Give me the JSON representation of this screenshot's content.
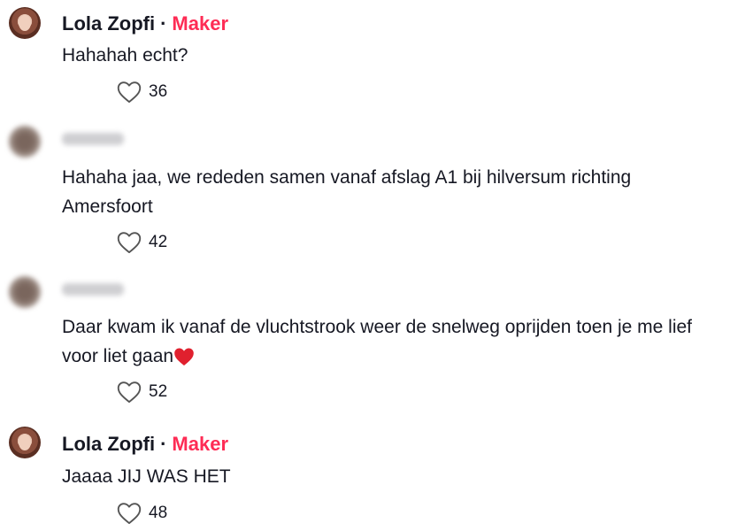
{
  "comments": [
    {
      "username": "Lola Zopfi",
      "separator": "·",
      "badge": "Maker",
      "text": "Hahahah echt?",
      "likes": "36"
    },
    {
      "username": "",
      "text": "Hahaha jaa, we rededen samen vanaf afslag A1 bij hilversum richting Amersfoort",
      "likes": "42"
    },
    {
      "username": "",
      "text": "Daar kwam ik vanaf de vluchtstrook weer de snelweg oprijden toen je me lief voor liet gaan",
      "emoji": "red-heart-emoji",
      "likes": "52"
    },
    {
      "username": "Lola Zopfi",
      "separator": "·",
      "badge": "Maker",
      "text": "Jaaaa JIJ WAS HET",
      "likes": "48"
    }
  ],
  "icons": {
    "like": "heart-outline-icon"
  },
  "colors": {
    "maker_badge": "#fe2c55",
    "text": "#161823"
  }
}
